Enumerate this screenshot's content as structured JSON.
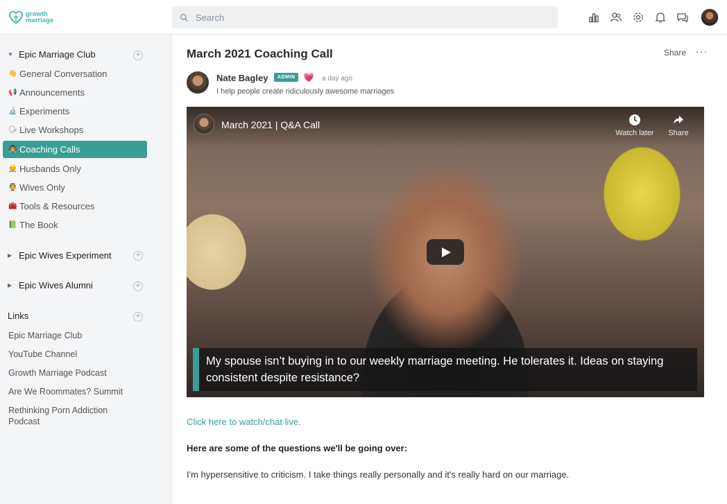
{
  "brand": {
    "logo_line1": "growth",
    "logo_line2": "marriage",
    "accent": "#3a9e96"
  },
  "search": {
    "placeholder": "Search"
  },
  "topbar_icons": [
    "leaderboard-icon",
    "members-icon",
    "settings-icon",
    "notifications-icon",
    "chat-icon"
  ],
  "sidebar": {
    "sections": [
      {
        "title": "Epic Marriage Club",
        "expanded": true
      },
      {
        "title": "Epic Wives Experiment",
        "expanded": false
      },
      {
        "title": "Epic Wives Alumni",
        "expanded": false
      },
      {
        "title": "Links"
      }
    ],
    "items": [
      {
        "emoji": "👋",
        "label": "General Conversation"
      },
      {
        "emoji": "📢",
        "label": "Announcements"
      },
      {
        "emoji": "🔬",
        "label": "Experiments"
      },
      {
        "emoji": "🗣",
        "label": "Live Workshops"
      },
      {
        "emoji": "👨‍🏫",
        "label": "Coaching Calls",
        "active": true
      },
      {
        "emoji": "👷",
        "label": "Husbands Only"
      },
      {
        "emoji": "👰",
        "label": "Wives Only"
      },
      {
        "emoji": "🧰",
        "label": "Tools & Resources"
      },
      {
        "emoji": "📗",
        "label": "The Book"
      }
    ],
    "links": [
      "Epic Marriage Club",
      "YouTube Channel",
      "Growth Marriage Podcast",
      "Are We Roommates? Summit",
      "Rethinking Porn Addiction Podcast"
    ]
  },
  "post": {
    "title": "March 2021 Coaching Call",
    "share_label": "Share",
    "more_label": "···",
    "author": {
      "name": "Nate Bagley",
      "badge": "ADMIN",
      "heart": "💗",
      "time": "a day ago",
      "bio": "I help people create ridiculously awesome marriages"
    },
    "video": {
      "title": "March 2021 | Q&A Call",
      "watch_later": "Watch later",
      "share": "Share",
      "caption": "My spouse isn’t buying in to our weekly marriage meeting. He tolerates it. Ideas on staying consistent despite resistance?"
    },
    "watch_link": "Click here to watch/chat live.",
    "questions_heading": "Here are some of the questions we'll be going over:",
    "question_1": "I'm hypersensitive to criticism. I take things really personally and it's really hard on our marriage."
  }
}
